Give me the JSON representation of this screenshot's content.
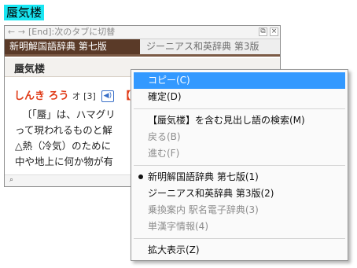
{
  "selected_word": "蜃気楼",
  "window": {
    "nav_back": "←",
    "nav_forward": "→",
    "nav_hint": "[End]:次のタブに切替",
    "restore_icon": "⧉",
    "close_icon": "×"
  },
  "tabs": [
    {
      "label": "新明解国語辞典 第七版",
      "active": true
    },
    {
      "label": "ジーニアス和英辞典 第3版",
      "active": false
    }
  ],
  "entry": {
    "headword": "蜃気楼",
    "reading": "しんき ろう",
    "accent_mark": "オ [3]",
    "audio_icon": "🔊",
    "bracket": "【",
    "line1": "〔「蜃」は、ハマグリ",
    "line2": "って現われるものと解",
    "line3": "△熱（冷気）のために",
    "line4": "中や地上に何か物が有"
  },
  "status": {
    "search_icon": "⌕"
  },
  "context_menu": {
    "items": [
      {
        "label": "コピー(C)",
        "state": "highlighted"
      },
      {
        "label": "確定(D)",
        "state": "normal"
      },
      {
        "label": "【蜃気楼】を含む見出し語の検索(M)",
        "state": "normal"
      },
      {
        "label": "戻る(B)",
        "state": "disabled"
      },
      {
        "label": "進む(F)",
        "state": "disabled"
      },
      {
        "label": "新明解国語辞典 第七版(1)",
        "state": "checked"
      },
      {
        "label": "ジーニアス和英辞典 第3版(2)",
        "state": "normal"
      },
      {
        "label": "乗換案内 駅名電子辞典(3)",
        "state": "disabled"
      },
      {
        "label": "単漢字情報(4)",
        "state": "disabled"
      },
      {
        "label": "拡大表示(Z)",
        "state": "normal"
      }
    ]
  },
  "colors": {
    "selection_highlight": "#19e6f2",
    "tab_active_bg": "#5a3a28",
    "reading_red": "#e03a16",
    "menu_highlight": "#3399ff"
  }
}
